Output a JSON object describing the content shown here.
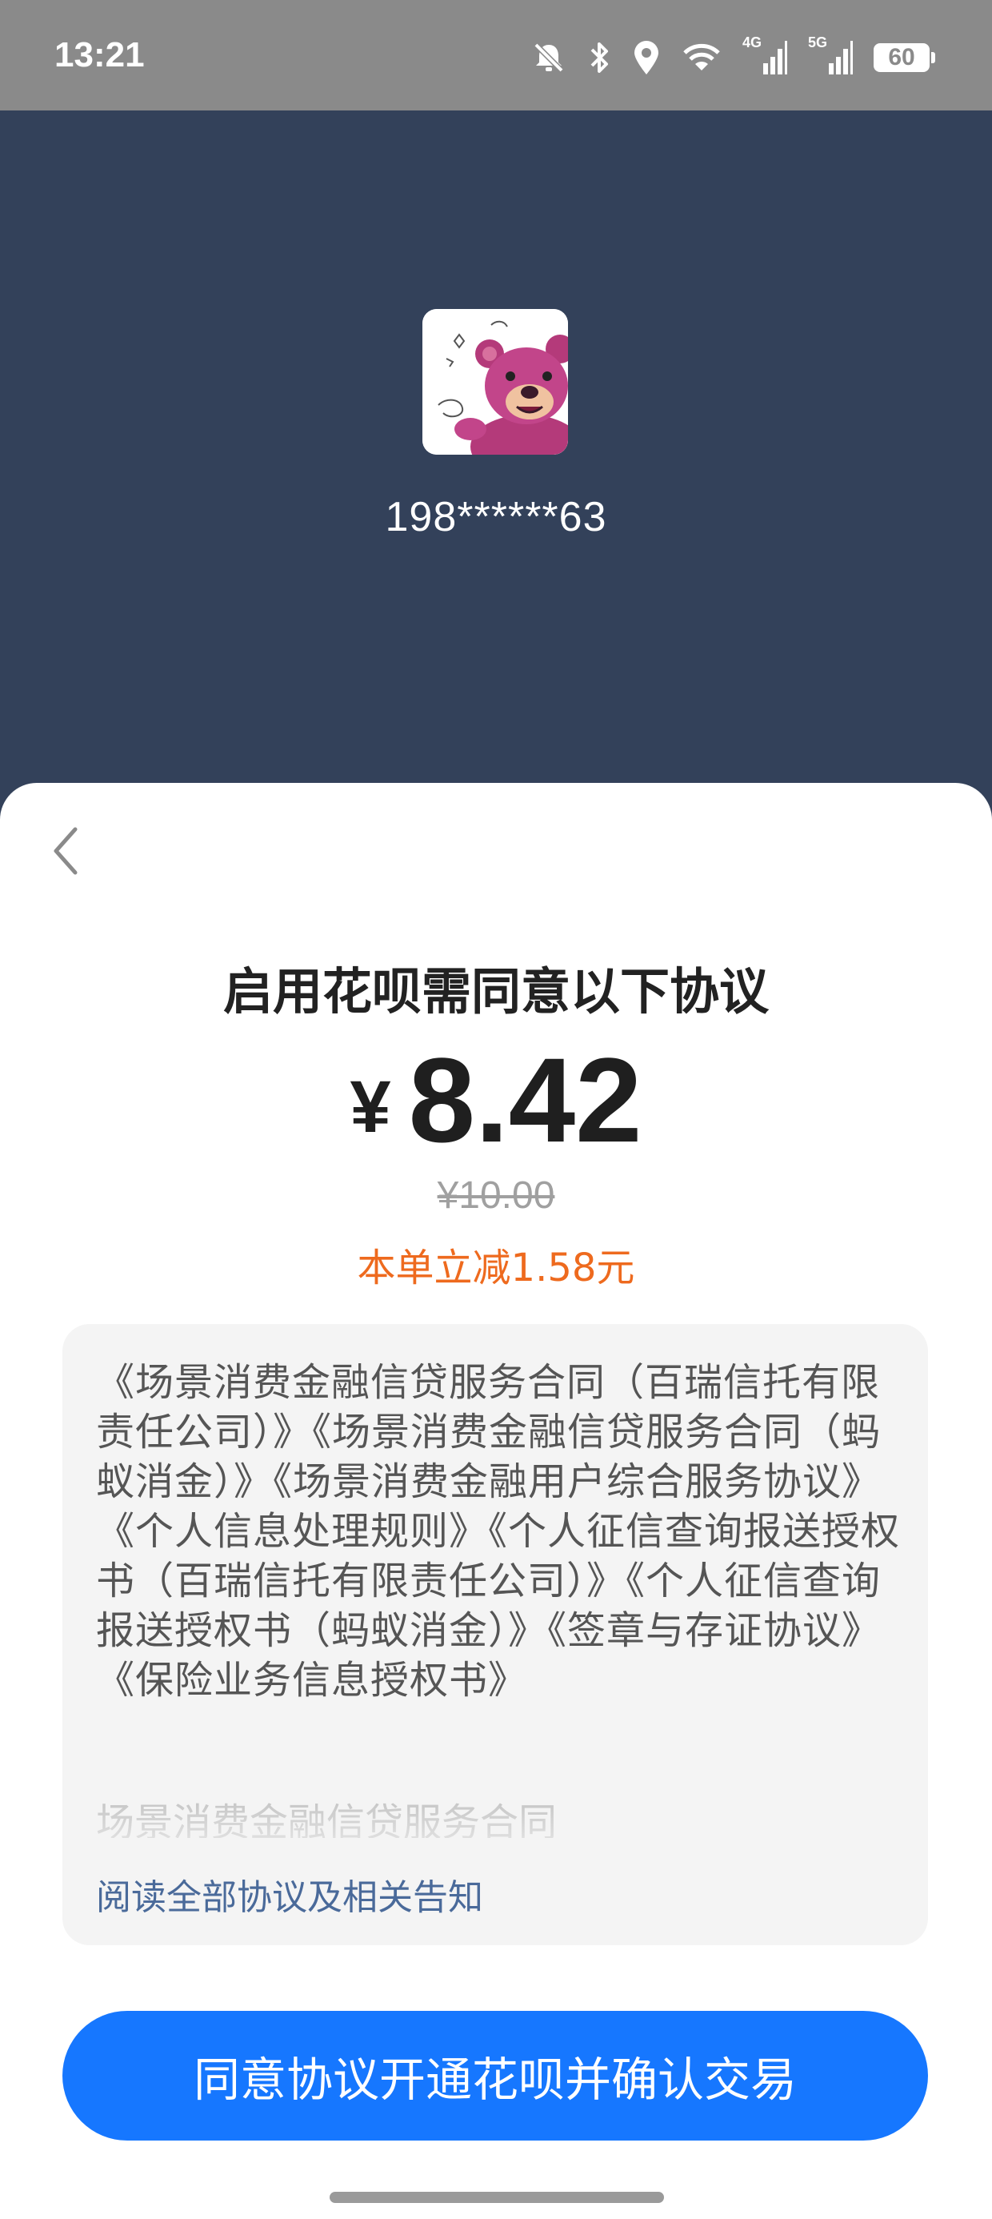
{
  "status_bar": {
    "time": "13:21",
    "icons": [
      "mute-icon",
      "bluetooth-icon",
      "location-icon",
      "wifi-icon",
      "signal-4g-icon",
      "signal-5g-icon"
    ],
    "sim1_label": "4G",
    "sim2_label": "5G",
    "battery": "60"
  },
  "account": {
    "avatar_icon": "pink-bear-avatar",
    "phone_masked": "198******63"
  },
  "sheet": {
    "back_icon": "chevron-left-icon",
    "title": "启用花呗需同意以下协议",
    "currency_symbol": "¥",
    "amount": "8.42",
    "original_price": "¥10.00",
    "discount_text": "本单立减1.58元",
    "agreements": "《场景消费金融信贷服务合同（百瑞信托有限责任公司）》《场景消费金融信贷服务合同（蚂蚁消金）》《场景消费金融用户综合服务协议》《个人信息处理规则》《个人征信查询报送授权书（百瑞信托有限责任公司）》《个人征信查询报送授权书（蚂蚁消金）》《签章与存证协议》《保险业务信息授权书》",
    "agreement_preview": "场景消费金融信贷服务合同",
    "read_all_link": "阅读全部协议及相关告知",
    "confirm_button": "同意协议开通花呗并确认交易"
  },
  "colors": {
    "header_bg": "#33415a",
    "status_bg": "#8a8a8a",
    "primary": "#1677ff",
    "discount": "#ee6a1e",
    "link": "#4a6a9a"
  }
}
